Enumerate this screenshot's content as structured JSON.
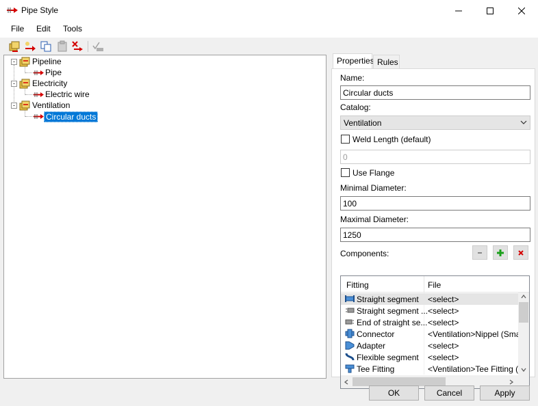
{
  "window": {
    "title": "Pipe Style"
  },
  "menu": {
    "file": "File",
    "edit": "Edit",
    "tools": "Tools"
  },
  "tree": {
    "nodes": [
      {
        "label": "Pipeline",
        "level": 0
      },
      {
        "label": "Pipe",
        "level": 1
      },
      {
        "label": "Electricity",
        "level": 0
      },
      {
        "label": "Electric wire",
        "level": 1
      },
      {
        "label": "Ventilation",
        "level": 0
      },
      {
        "label": "Circular ducts",
        "level": 1,
        "selected": true
      }
    ],
    "expander": "-"
  },
  "tabs": {
    "properties": "Properties",
    "rules": "Rules"
  },
  "form": {
    "name_label": "Name:",
    "name_value": "Circular ducts",
    "catalog_label": "Catalog:",
    "catalog_value": "Ventilation",
    "weld_label": "Weld Length (default)",
    "weld_value": "0",
    "flange_label": "Use Flange",
    "min_label": "Minimal Diameter:",
    "min_value": "100",
    "max_label": "Maximal Diameter:",
    "max_value": "1250",
    "components_label": "Components:"
  },
  "grid": {
    "headers": {
      "fitting": "Fitting",
      "file": "File"
    },
    "rows": [
      {
        "fitting": "Straight segment",
        "file": "<select>"
      },
      {
        "fitting": "Straight segment ...",
        "file": "<select>"
      },
      {
        "fitting": "End of straight se...",
        "file": "<select>"
      },
      {
        "fitting": "Connector",
        "file": "<Ventilation>Nippel (Smart).c"
      },
      {
        "fitting": "Adapter",
        "file": "<select>"
      },
      {
        "fitting": "Flexible segment",
        "file": "<select>"
      },
      {
        "fitting": "Tee Fitting",
        "file": "<Ventilation>Tee Fitting (Sm"
      }
    ]
  },
  "buttons": {
    "ok": "OK",
    "cancel": "Cancel",
    "apply": "Apply"
  },
  "colors": {
    "selection": "#0078d7",
    "accent_red": "#d40000",
    "plus_green": "#1ba01b",
    "folder_yellow": "#e8c048"
  }
}
